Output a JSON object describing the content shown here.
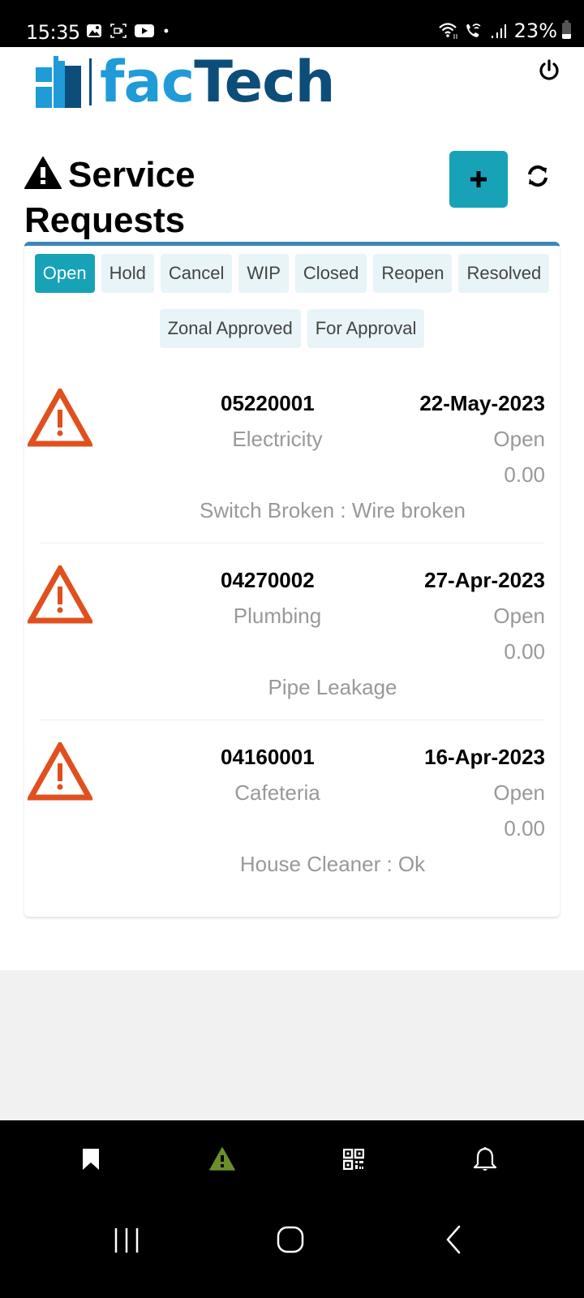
{
  "status_bar": {
    "time": "15:35",
    "left_icons": [
      "gallery-icon",
      "screen-record-icon",
      "youtube-icon",
      "dot-icon"
    ],
    "right_icons": [
      "wifi-icon",
      "wifi-call-icon",
      "signal-icon"
    ],
    "battery": "23%"
  },
  "header": {
    "logo_part1": "fac",
    "logo_part2": "Tech",
    "power_icon": "power-icon"
  },
  "page": {
    "title": "Service Requests",
    "title_icon": "warning-icon",
    "add_icon": "plus-icon",
    "refresh_icon": "refresh-icon"
  },
  "filters": [
    {
      "label": "Open",
      "active": true
    },
    {
      "label": "Hold",
      "active": false
    },
    {
      "label": "Cancel",
      "active": false
    },
    {
      "label": "WIP",
      "active": false
    },
    {
      "label": "Closed",
      "active": false
    },
    {
      "label": "Reopen",
      "active": false
    },
    {
      "label": "Resolved",
      "active": false
    },
    {
      "label": "Zonal Approved",
      "active": false
    },
    {
      "label": "For Approval",
      "active": false
    }
  ],
  "requests": [
    {
      "number": "05220001",
      "date": "22-May-2023",
      "category": "Electricity",
      "status": "Open",
      "amount": "0.00",
      "description": "Switch Broken : Wire broken"
    },
    {
      "number": "04270002",
      "date": "27-Apr-2023",
      "category": "Plumbing",
      "status": "Open",
      "amount": "0.00",
      "description": "Pipe Leakage"
    },
    {
      "number": "04160001",
      "date": "16-Apr-2023",
      "category": "Cafeteria",
      "status": "Open",
      "amount": "0.00",
      "description": "House Cleaner : Ok"
    }
  ],
  "bottom_nav": [
    {
      "icon": "bookmark-icon",
      "active": false
    },
    {
      "icon": "warning-icon",
      "active": true
    },
    {
      "icon": "qr-code-icon",
      "active": false
    },
    {
      "icon": "bell-icon",
      "active": false
    }
  ],
  "colors": {
    "accent": "#17a2b8",
    "card_border": "#3b87b6",
    "logo_light": "#1f9bd8",
    "logo_dark": "#0d4d7a",
    "alert": "#e0501e",
    "nav_active": "#6a8f2a"
  }
}
